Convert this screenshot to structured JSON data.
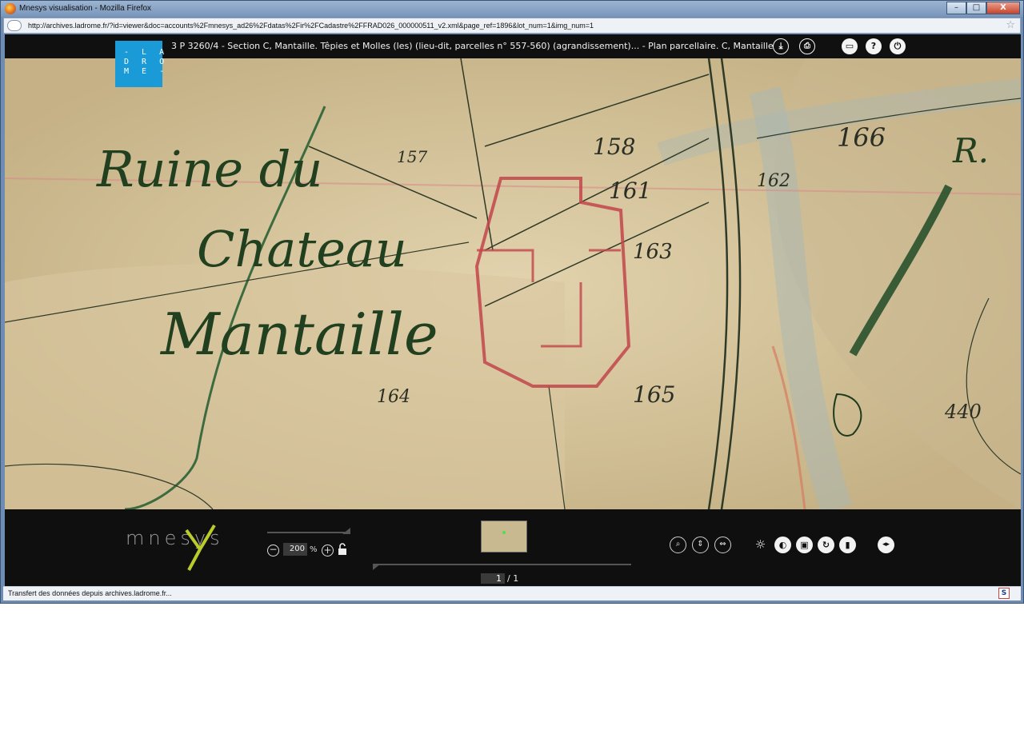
{
  "window": {
    "title": "Mnesys visualisation - Mozilla Firefox",
    "minimize_label": "–",
    "maximize_label": "□",
    "close_label": "X"
  },
  "address_bar": {
    "url": "http://archives.ladrome.fr/?id=viewer&doc=accounts%2Fmnesys_ad26%2Fdatas%2Fir%2FCadastre%2FFRAD026_000000511_v2.xml&page_ref=1896&lot_num=1&img_num=1"
  },
  "viewer": {
    "logo_text": "- L A\nD R O\nM E -",
    "document_title": "3 P 3260/4 - Section  C, Mantaille. Têpies et Molles (les) (lieu-dit, parcelles n° 557-560) (agrandissement)... - Plan parcellaire. C, Mantaille",
    "toolbar": {
      "download_icon": "download-icon",
      "print_icon": "print-icon",
      "fullscreen_icon": "fullscreen-icon",
      "help_label": "?",
      "power_icon": "power-icon"
    },
    "map": {
      "labels": [
        "Ruine du",
        "Chateau",
        "Mantaille",
        "158",
        "161",
        "163",
        "162",
        "166",
        "164",
        "165",
        "157",
        "440",
        "R."
      ],
      "colors": {
        "paper": "#d6c49e",
        "ink": "#1f3b1e",
        "red": "#c2454a"
      }
    }
  },
  "bottom": {
    "brand": "mnesys",
    "zoom": {
      "value": "200",
      "unit": "%"
    },
    "page": {
      "current": "1",
      "total": "/ 1"
    },
    "tools": [
      "zoom-area-icon",
      "fit-height-icon",
      "fit-width-icon",
      "brightness-icon",
      "contrast-icon",
      "image-icon",
      "rotate-icon",
      "lock-icon",
      "navigate-icon"
    ]
  },
  "status_bar": {
    "text": "Transfert des données depuis archives.ladrome.fr...",
    "badge": "S"
  }
}
